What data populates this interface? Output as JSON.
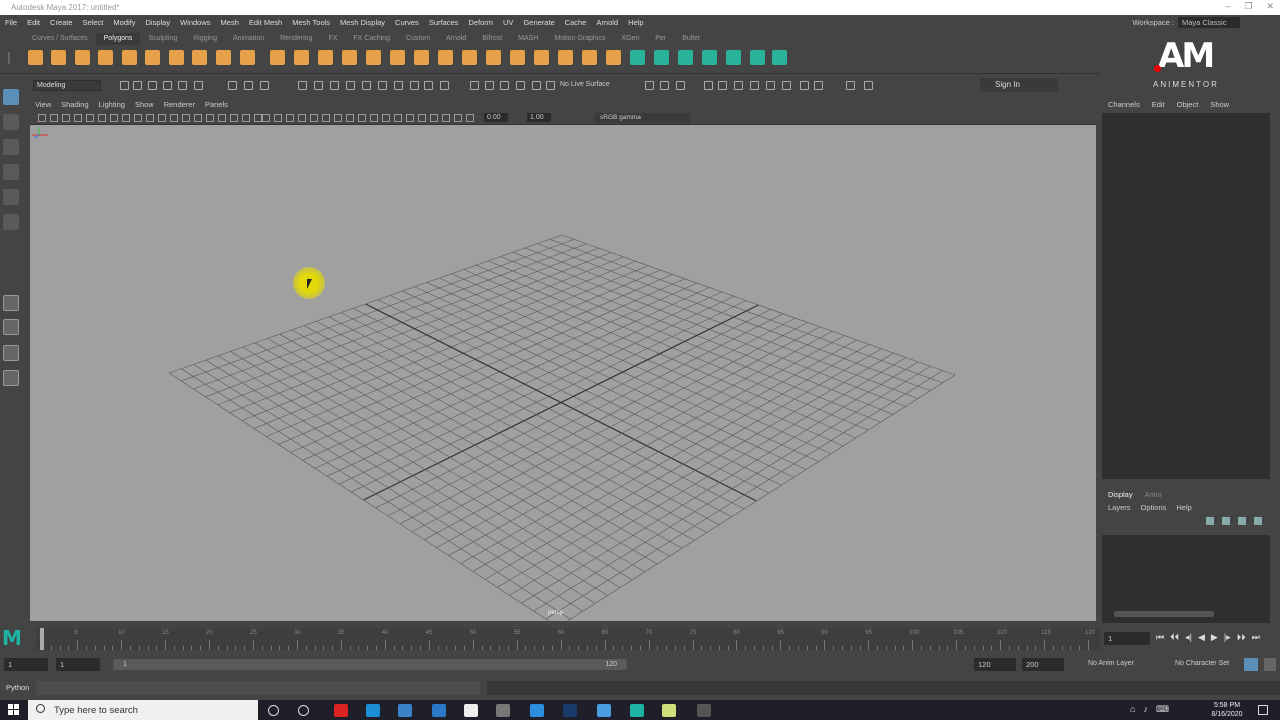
{
  "window": {
    "title": "Autodesk Maya 2017: untitled*",
    "controls": [
      "–",
      "❐",
      "✕"
    ]
  },
  "menubar": {
    "items": [
      "File",
      "Edit",
      "Create",
      "Select",
      "Modify",
      "Display",
      "Windows",
      "Mesh",
      "Edit Mesh",
      "Mesh Tools",
      "Mesh Display",
      "Curves",
      "Surfaces",
      "Deform",
      "UV",
      "Generate",
      "Cache",
      "Arnold",
      "Help"
    ],
    "workspace_label": "Workspace :",
    "workspace_value": "Maya Classic"
  },
  "shelf": {
    "tabs": [
      "Curves / Surfaces",
      "Polygons",
      "Sculpting",
      "Rigging",
      "Animation",
      "Rendering",
      "FX",
      "FX Caching",
      "Custom",
      "Arnold",
      "Bifrost",
      "MASH",
      "Motion Graphics",
      "XGen",
      "Per",
      "Bullet"
    ],
    "active_tab": "Polygons",
    "icon_color": "#e5a04a",
    "icon_color2": "#2ab39a"
  },
  "statusline": {
    "mode": "Modeling",
    "no_live_surface": "No Live Surface",
    "signin": "Sign In"
  },
  "logo": {
    "text": "AM",
    "sub": "ANIMENTOR"
  },
  "viewport": {
    "menu": [
      "View",
      "Shading",
      "Lighting",
      "Show",
      "Renderer",
      "Panels"
    ],
    "exposure": "0.00",
    "gamma": "1.00",
    "colorspace": "sRGB gamma",
    "camera_label": "persp",
    "bg_color": "#a0a0a0"
  },
  "channelbox": {
    "menu": [
      "Channels",
      "Edit",
      "Object",
      "Show"
    ]
  },
  "layereditor": {
    "tabs": [
      "Display",
      "Anim"
    ],
    "active_tab": "Display",
    "menu": [
      "Layers",
      "Options",
      "Help"
    ]
  },
  "timeslider": {
    "ticks": [
      "1",
      "5",
      "10",
      "15",
      "20",
      "25",
      "30",
      "35",
      "40",
      "45",
      "50",
      "55",
      "60",
      "65",
      "70",
      "75",
      "80",
      "85",
      "90",
      "95",
      "100",
      "105",
      "110",
      "115",
      "120"
    ],
    "current_frame": "1",
    "playback": [
      "⏮",
      "⏴⏴",
      "◂|",
      "◀",
      "▶",
      "|▸",
      "⏵⏵",
      "⏭"
    ]
  },
  "rangeslider": {
    "start": "1",
    "anim_start": "1",
    "range_start": "1",
    "range_end": "120",
    "anim_end": "120",
    "end": "200",
    "anim_layer": "No Anim Layer",
    "char_set": "No Character Set"
  },
  "cmdline": {
    "label": "Python"
  },
  "taskbar": {
    "search_placeholder": "Type here to search",
    "time": "5:58 PM",
    "date": "8/16/2020"
  }
}
